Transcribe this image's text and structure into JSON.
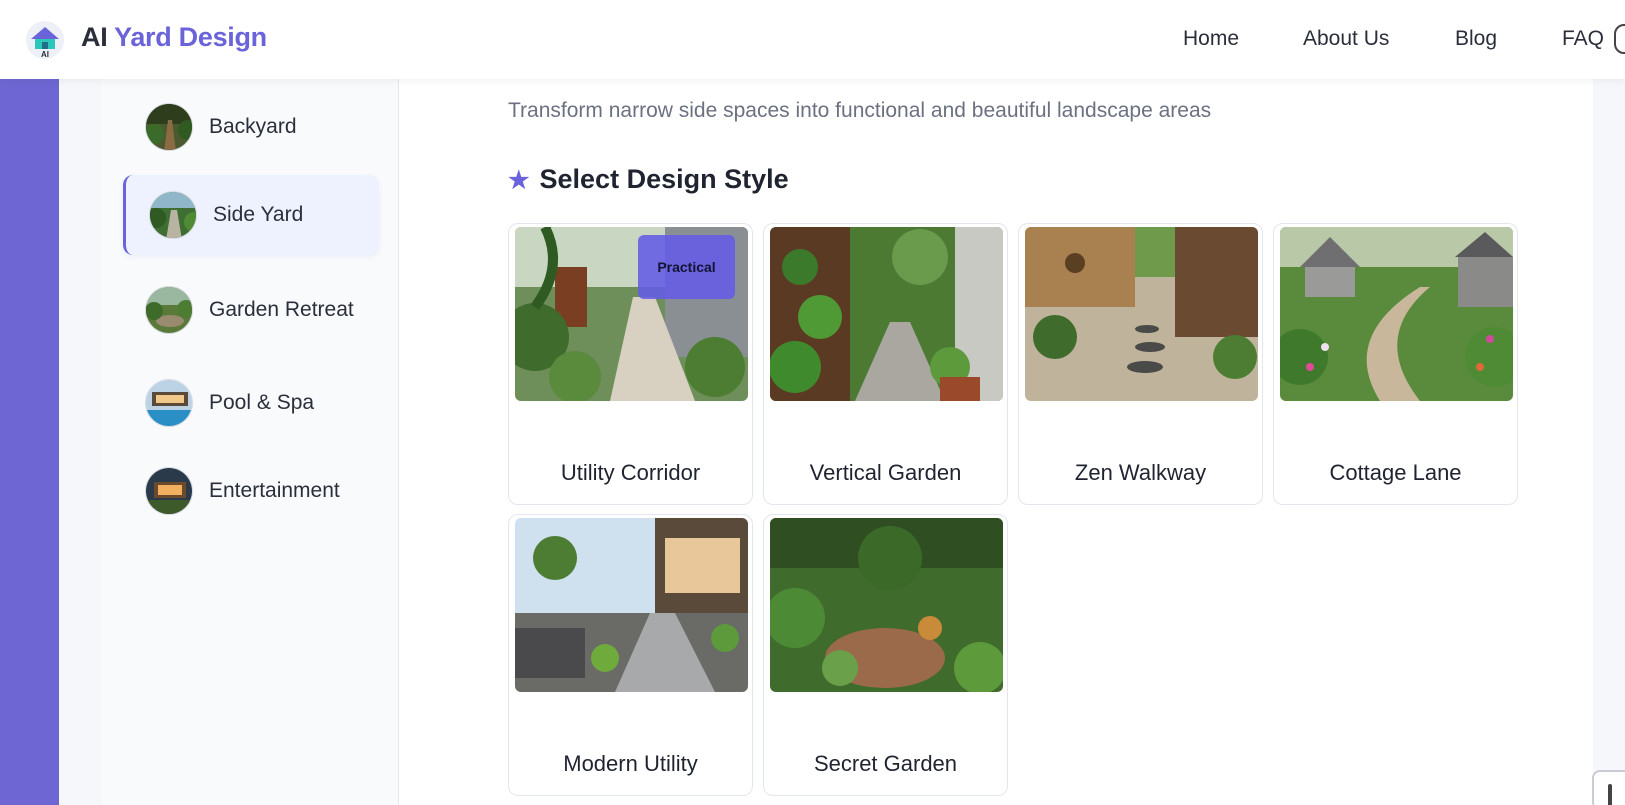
{
  "header": {
    "logo_prefix": "AI ",
    "logo_accent": "Yard Design",
    "logo_badge": "AI",
    "nav": [
      "Home",
      "About Us",
      "Blog",
      "FAQ"
    ]
  },
  "sidebar": {
    "items": [
      {
        "label": "Backyard",
        "icon": "backyard-thumbnail",
        "active": false
      },
      {
        "label": "Side Yard",
        "icon": "side-yard-thumbnail",
        "active": true
      },
      {
        "label": "Garden Retreat",
        "icon": "garden-retreat-thumbnail",
        "active": false
      },
      {
        "label": "Pool & Spa",
        "icon": "pool-spa-thumbnail",
        "active": false
      },
      {
        "label": "Entertainment",
        "icon": "entertainment-thumbnail",
        "active": false
      }
    ]
  },
  "main": {
    "subtitle": "Transform narrow side spaces into functional and beautiful landscape areas",
    "section_title": "Select Design Style",
    "section_icon": "star-icon",
    "styles": [
      {
        "label": "Utility Corridor",
        "badge": "Practical"
      },
      {
        "label": "Vertical Garden"
      },
      {
        "label": "Zen Walkway"
      },
      {
        "label": "Cottage Lane"
      },
      {
        "label": "Modern Utility"
      },
      {
        "label": "Secret Garden"
      }
    ]
  },
  "colors": {
    "accent": "#6b63d9",
    "strip": "#6e67d3",
    "badge": "#645ce6"
  }
}
